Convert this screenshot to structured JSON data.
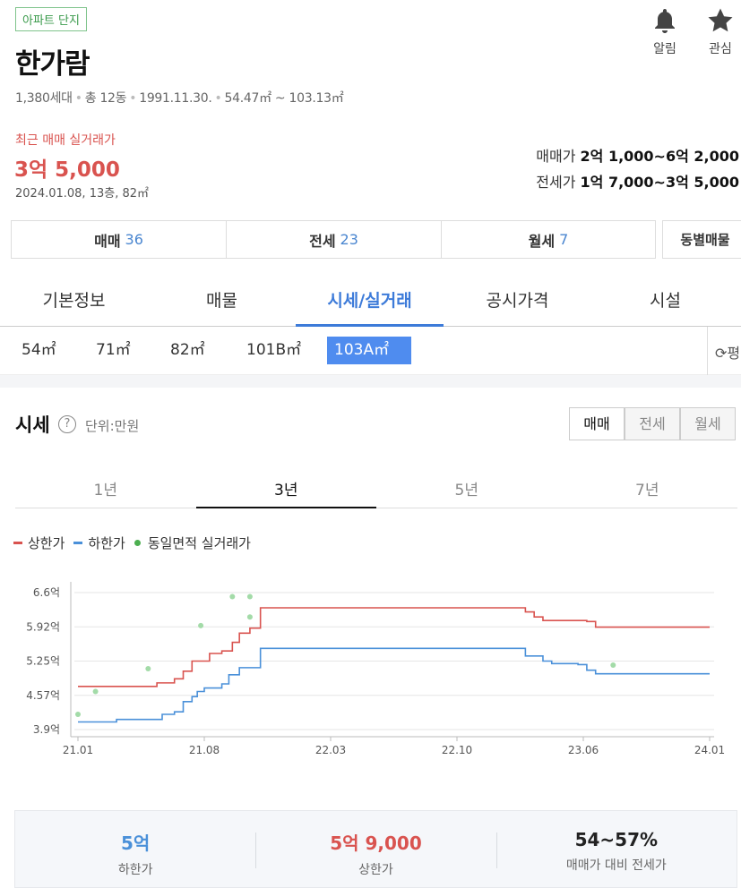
{
  "header": {
    "tag": "아파트 단지",
    "name": "한가람",
    "info": [
      "1,380세대",
      "총 12동",
      "1991.11.30.",
      "54.47㎡ ~ 103.13㎡"
    ],
    "alarm_label": "알림",
    "favorite_label": "관심"
  },
  "recent": {
    "label": "최근 매매 실거래가",
    "price": "3억 5,000",
    "meta": "2024.01.08, 13층, 82㎡"
  },
  "ranges": {
    "sale_label": "매매가",
    "sale_value": "2억 1,000~6억 2,000",
    "jeonse_label": "전세가",
    "jeonse_value": "1억 7,000~3억 5,000"
  },
  "count_tabs": [
    {
      "label": "매매",
      "count": "36"
    },
    {
      "label": "전세",
      "count": "23"
    },
    {
      "label": "월세",
      "count": "7"
    }
  ],
  "by_building_label": "동별매물",
  "main_tabs": [
    "기본정보",
    "매물",
    "시세/실거래",
    "공시가격",
    "시설"
  ],
  "area_tabs": [
    "54㎡",
    "71㎡",
    "82㎡",
    "101B㎡",
    "103A㎡"
  ],
  "refresh_label": "평",
  "sise": {
    "title": "시세",
    "help": "?",
    "unit": "단위:만원",
    "deal_types": [
      "매매",
      "전세",
      "월세"
    ],
    "periods": [
      "1년",
      "3년",
      "5년",
      "7년"
    ]
  },
  "legend": {
    "upper": "상한가",
    "lower": "하한가",
    "deals": "동일면적 실거래가"
  },
  "colors": {
    "upper": "#d9534f",
    "lower": "#4a90d9",
    "deal": "#a3dba8",
    "accent": "#3d7bd9"
  },
  "chart_data": {
    "type": "line",
    "x_ticks": [
      "21.01",
      "21.08",
      "22.03",
      "22.10",
      "23.06",
      "24.01"
    ],
    "y_ticks": [
      "6.6억",
      "5.92억",
      "5.25억",
      "4.57억",
      "3.9억"
    ],
    "ylim": [
      3.9,
      6.6
    ],
    "x_range_months": [
      0,
      36
    ],
    "series": [
      {
        "name": "상한가",
        "points": [
          [
            0,
            4.75
          ],
          [
            4,
            4.75
          ],
          [
            4.5,
            4.82
          ],
          [
            5.5,
            4.9
          ],
          [
            6,
            5.05
          ],
          [
            6.5,
            5.25
          ],
          [
            7.5,
            5.4
          ],
          [
            8,
            5.4
          ],
          [
            8.2,
            5.45
          ],
          [
            8.8,
            5.62
          ],
          [
            9.2,
            5.8
          ],
          [
            9.8,
            5.9
          ],
          [
            10.2,
            5.9
          ],
          [
            10.4,
            6.3
          ],
          [
            25,
            6.3
          ],
          [
            25.5,
            6.22
          ],
          [
            26,
            6.12
          ],
          [
            26.5,
            6.05
          ],
          [
            29,
            6.03
          ],
          [
            29.5,
            5.92
          ],
          [
            36,
            5.92
          ]
        ]
      },
      {
        "name": "하한가",
        "points": [
          [
            0,
            4.05
          ],
          [
            2,
            4.05
          ],
          [
            2.2,
            4.1
          ],
          [
            4.5,
            4.1
          ],
          [
            4.8,
            4.2
          ],
          [
            5.5,
            4.25
          ],
          [
            6,
            4.45
          ],
          [
            6.5,
            4.55
          ],
          [
            6.8,
            4.65
          ],
          [
            7.2,
            4.72
          ],
          [
            8,
            4.72
          ],
          [
            8.2,
            4.8
          ],
          [
            8.6,
            4.98
          ],
          [
            9.2,
            5.12
          ],
          [
            10.2,
            5.12
          ],
          [
            10.4,
            5.5
          ],
          [
            25,
            5.5
          ],
          [
            25.5,
            5.35
          ],
          [
            26.5,
            5.25
          ],
          [
            27,
            5.2
          ],
          [
            28.5,
            5.18
          ],
          [
            29,
            5.07
          ],
          [
            29.5,
            5.0
          ],
          [
            36,
            5.0
          ]
        ]
      }
    ],
    "deals": [
      [
        0,
        4.2
      ],
      [
        1,
        4.65
      ],
      [
        4,
        5.1
      ],
      [
        7,
        5.95
      ],
      [
        8.8,
        6.52
      ],
      [
        9.8,
        6.52
      ],
      [
        9.8,
        6.12
      ],
      [
        30.5,
        5.17
      ]
    ]
  },
  "summary": [
    {
      "value": "5억",
      "label": "하한가",
      "color": "#4a90d9"
    },
    {
      "value": "5억 9,000",
      "label": "상한가",
      "color": "#d9534f"
    },
    {
      "value": "54~57%",
      "label": "매매가 대비 전세가",
      "color": "#222"
    }
  ]
}
